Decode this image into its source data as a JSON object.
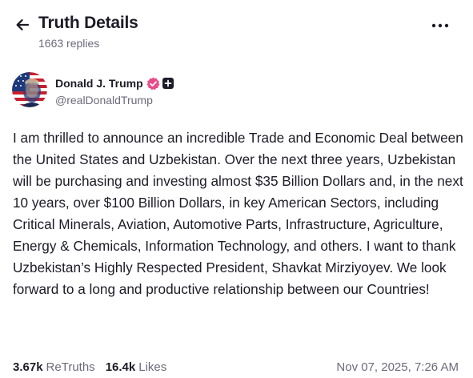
{
  "header": {
    "title": "Truth Details",
    "reply_count": "1663 replies",
    "back_icon": "arrow-left-icon",
    "more_icon": "more-horizontal-icon"
  },
  "author": {
    "display_name": "Donald J. Trump",
    "handle": "@realDonaldTrump",
    "verified_icon": "verified-badge-icon",
    "plus_icon": "plus-badge-icon"
  },
  "post": {
    "text": "I am thrilled to announce an incredible Trade and Economic Deal between the United States and Uzbekistan. Over the next three years, Uzbekistan will be purchasing and investing almost $35 Billion Dollars and, in the next 10 years, over $100 Billion Dollars, in key American Sectors, including Critical Minerals, Aviation, Automotive Parts, Infrastructure, Agriculture, Energy & Chemicals, Information Technology, and others. I want to thank Uzbekistan’s Highly Respected President, Shavkat Mirziyoyev. We look forward to a long and productive relationship between our Countries!"
  },
  "stats": {
    "retruths_value": "3.67k",
    "retruths_label": "ReTruths",
    "likes_value": "16.4k",
    "likes_label": "Likes",
    "timestamp": "Nov 07, 2025, 7:26 AM"
  },
  "colors": {
    "text_primary": "#1c1c28",
    "text_secondary": "#6b6b7b",
    "verified": "#e94b8a",
    "background": "#ffffff"
  }
}
